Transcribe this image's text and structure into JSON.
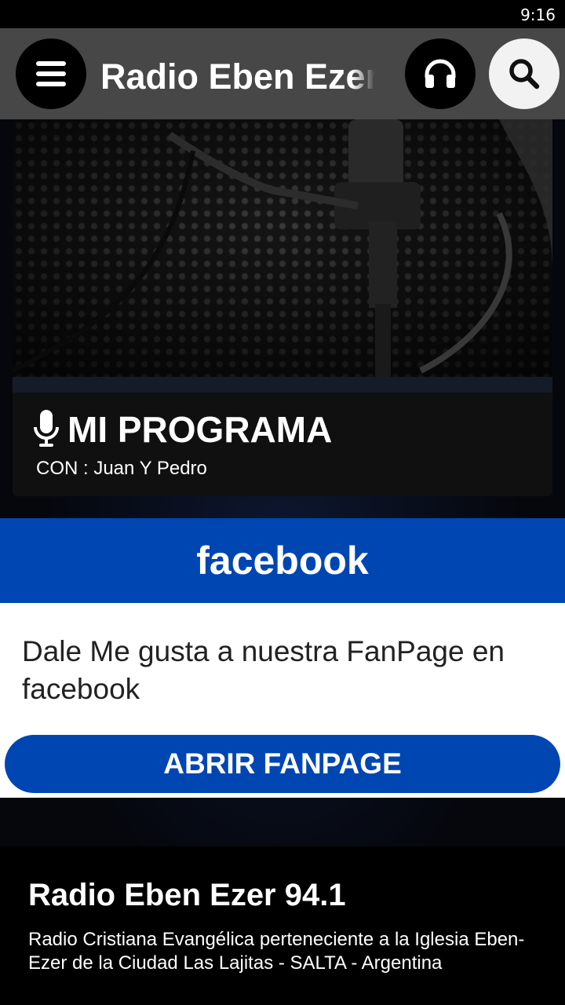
{
  "status_bar": {
    "time": "9:16"
  },
  "toolbar": {
    "title": "Radio Eben Ezer",
    "menu_icon": "menu-icon",
    "headphones_icon": "headphones-icon",
    "search_icon": "search-icon"
  },
  "program": {
    "icon": "microphone-icon",
    "title": "MI PROGRAMA",
    "host": "CON : Juan Y Pedro"
  },
  "facebook": {
    "header": "facebook",
    "text": "Dale Me gusta a nuestra FanPage en facebook",
    "button_label": "ABRIR FANPAGE",
    "color": "#0046b2"
  },
  "footer": {
    "title": "Radio Eben Ezer 94.1",
    "description": "Radio Cristiana Evangélica perteneciente a la Iglesia Eben-Ezer de la Ciudad Las Lajitas - SALTA - Argentina"
  }
}
